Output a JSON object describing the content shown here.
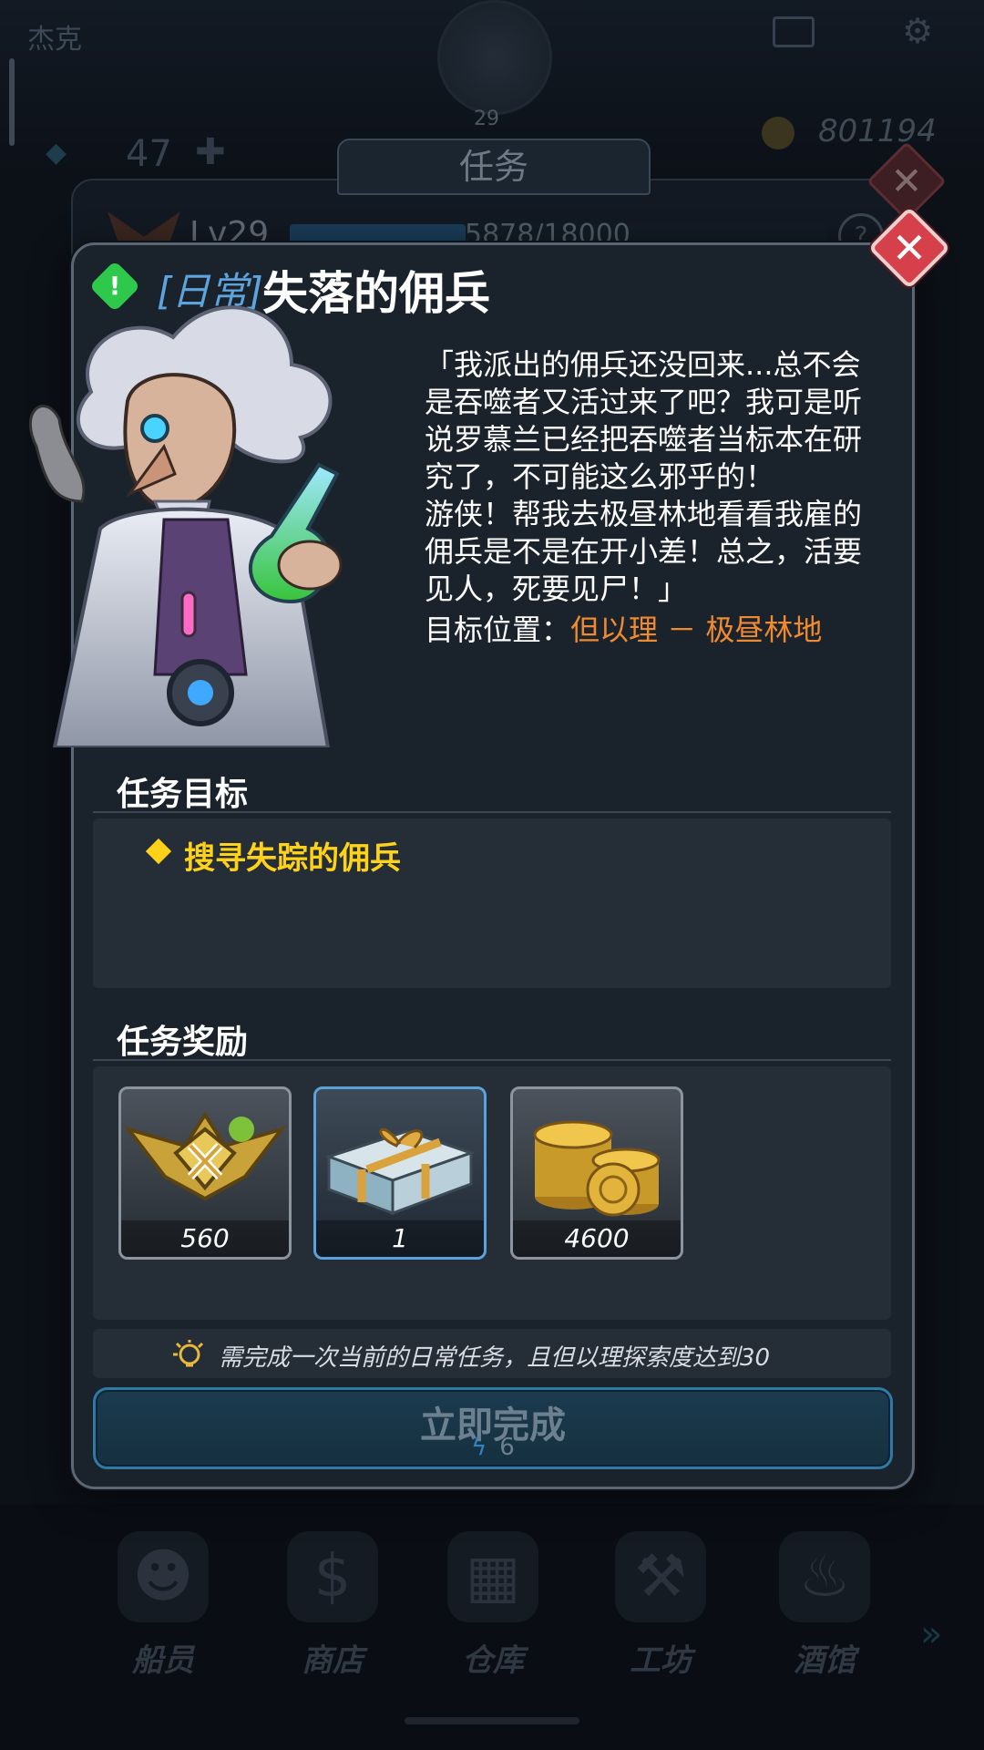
{
  "background": {
    "player_name": "杰克",
    "avatar_level": "29",
    "gold": "801194",
    "energy": "47",
    "nav": [
      {
        "label": "船员",
        "icon": "crew-icon"
      },
      {
        "label": "商店",
        "icon": "shop-icon"
      },
      {
        "label": "仓库",
        "icon": "warehouse-icon"
      },
      {
        "label": "工坊",
        "icon": "workshop-icon"
      },
      {
        "label": "酒馆",
        "icon": "tavern-icon"
      }
    ],
    "panel": {
      "tab_title": "任务",
      "level": "Lv29",
      "xp": "5878/18000",
      "xp_fraction": 0.3266,
      "help": "?"
    }
  },
  "quest": {
    "tag": "[日常]",
    "title": "失落的佣兵",
    "description": [
      "「我派出的佣兵还没回来...总不会",
      "是吞噬者又活过来了吧？我可是听",
      "说罗慕兰已经把吞噬者当标本在研",
      "究了，不可能这么邪乎的！",
      "游侠！帮我去极昼林地看看我雇的",
      "佣兵是不是在开小差！总之，活要",
      "见人，死要见尸！」"
    ],
    "target_label": "目标位置：",
    "target_value": "但以理 － 极昼林地",
    "objectives_title": "任务目标",
    "objective": "搜寻失踪的佣兵",
    "rewards_title": "任务奖励",
    "rewards": [
      {
        "count": "560",
        "icon": "rank-emblem-icon"
      },
      {
        "count": "1",
        "icon": "gift-box-icon"
      },
      {
        "count": "4600",
        "icon": "gold-coins-icon"
      }
    ],
    "requirement": "需完成一次当前的日常任务，且但以理探索度达到30",
    "complete_button": "立即完成",
    "complete_cost": "6"
  },
  "colors": {
    "accent_blue": "#5aa2dc",
    "objective_yellow": "#ffd21a",
    "location_orange": "#ee8a30",
    "close_red": "#d5404b",
    "daily_green": "#2ec84a"
  }
}
